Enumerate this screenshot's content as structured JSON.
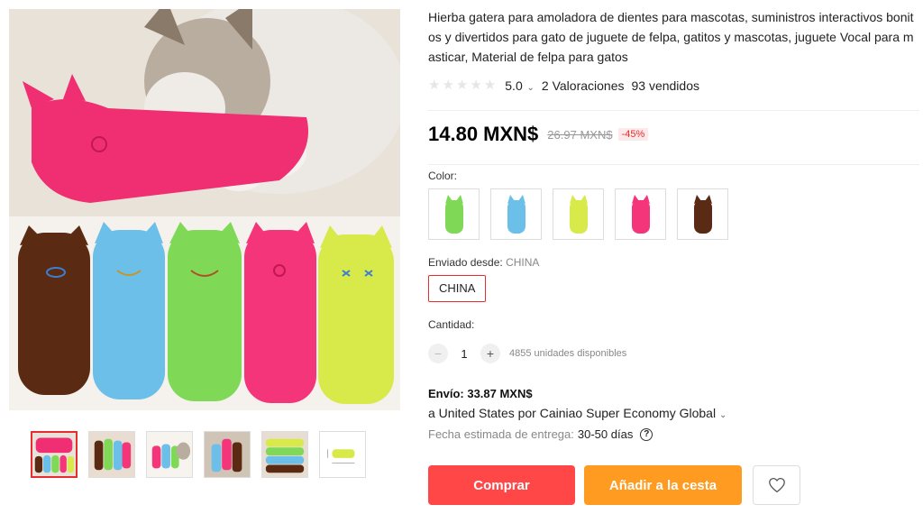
{
  "product": {
    "title": "Hierba gatera para amoladora de dientes para mascotas, suministros interactivos bonitos y divertidos para gato de juguete de felpa, gatitos y mascotas, juguete Vocal para masticar, Material de felpa para gatos",
    "rating_score": "5.0",
    "reviews": "2 Valoraciones",
    "sold": "93 vendidos"
  },
  "price": {
    "current": "14.80 MXN$",
    "original": "26.97 MXN$",
    "discount": "-45%"
  },
  "color": {
    "label": "Color:",
    "options": [
      {
        "name": "green",
        "color": "#7fd957"
      },
      {
        "name": "blue",
        "color": "#6bbfe8"
      },
      {
        "name": "yellow",
        "color": "#d8e94a"
      },
      {
        "name": "pink",
        "color": "#f4357a"
      },
      {
        "name": "brown",
        "color": "#5a2a14"
      }
    ]
  },
  "ships_from": {
    "label": "Enviado desde:",
    "value": "CHINA",
    "option": "CHINA"
  },
  "quantity": {
    "label": "Cantidad:",
    "value": "1",
    "minus": "−",
    "plus": "+",
    "available": "4855 unidades disponibles"
  },
  "shipping": {
    "cost": "Envío: 33.87 MXN$",
    "route": "a United States por Cainiao Super Economy Global",
    "delivery_label": "Fecha estimada de entrega:",
    "delivery_days": "30-50 días",
    "help": "?"
  },
  "actions": {
    "buy": "Comprar",
    "cart": "Añadir a la cesta"
  },
  "icons": {
    "star": "star-icon",
    "wishlist": "heart-icon",
    "chevron": "chevron-down-icon",
    "help": "question-circle-icon"
  }
}
